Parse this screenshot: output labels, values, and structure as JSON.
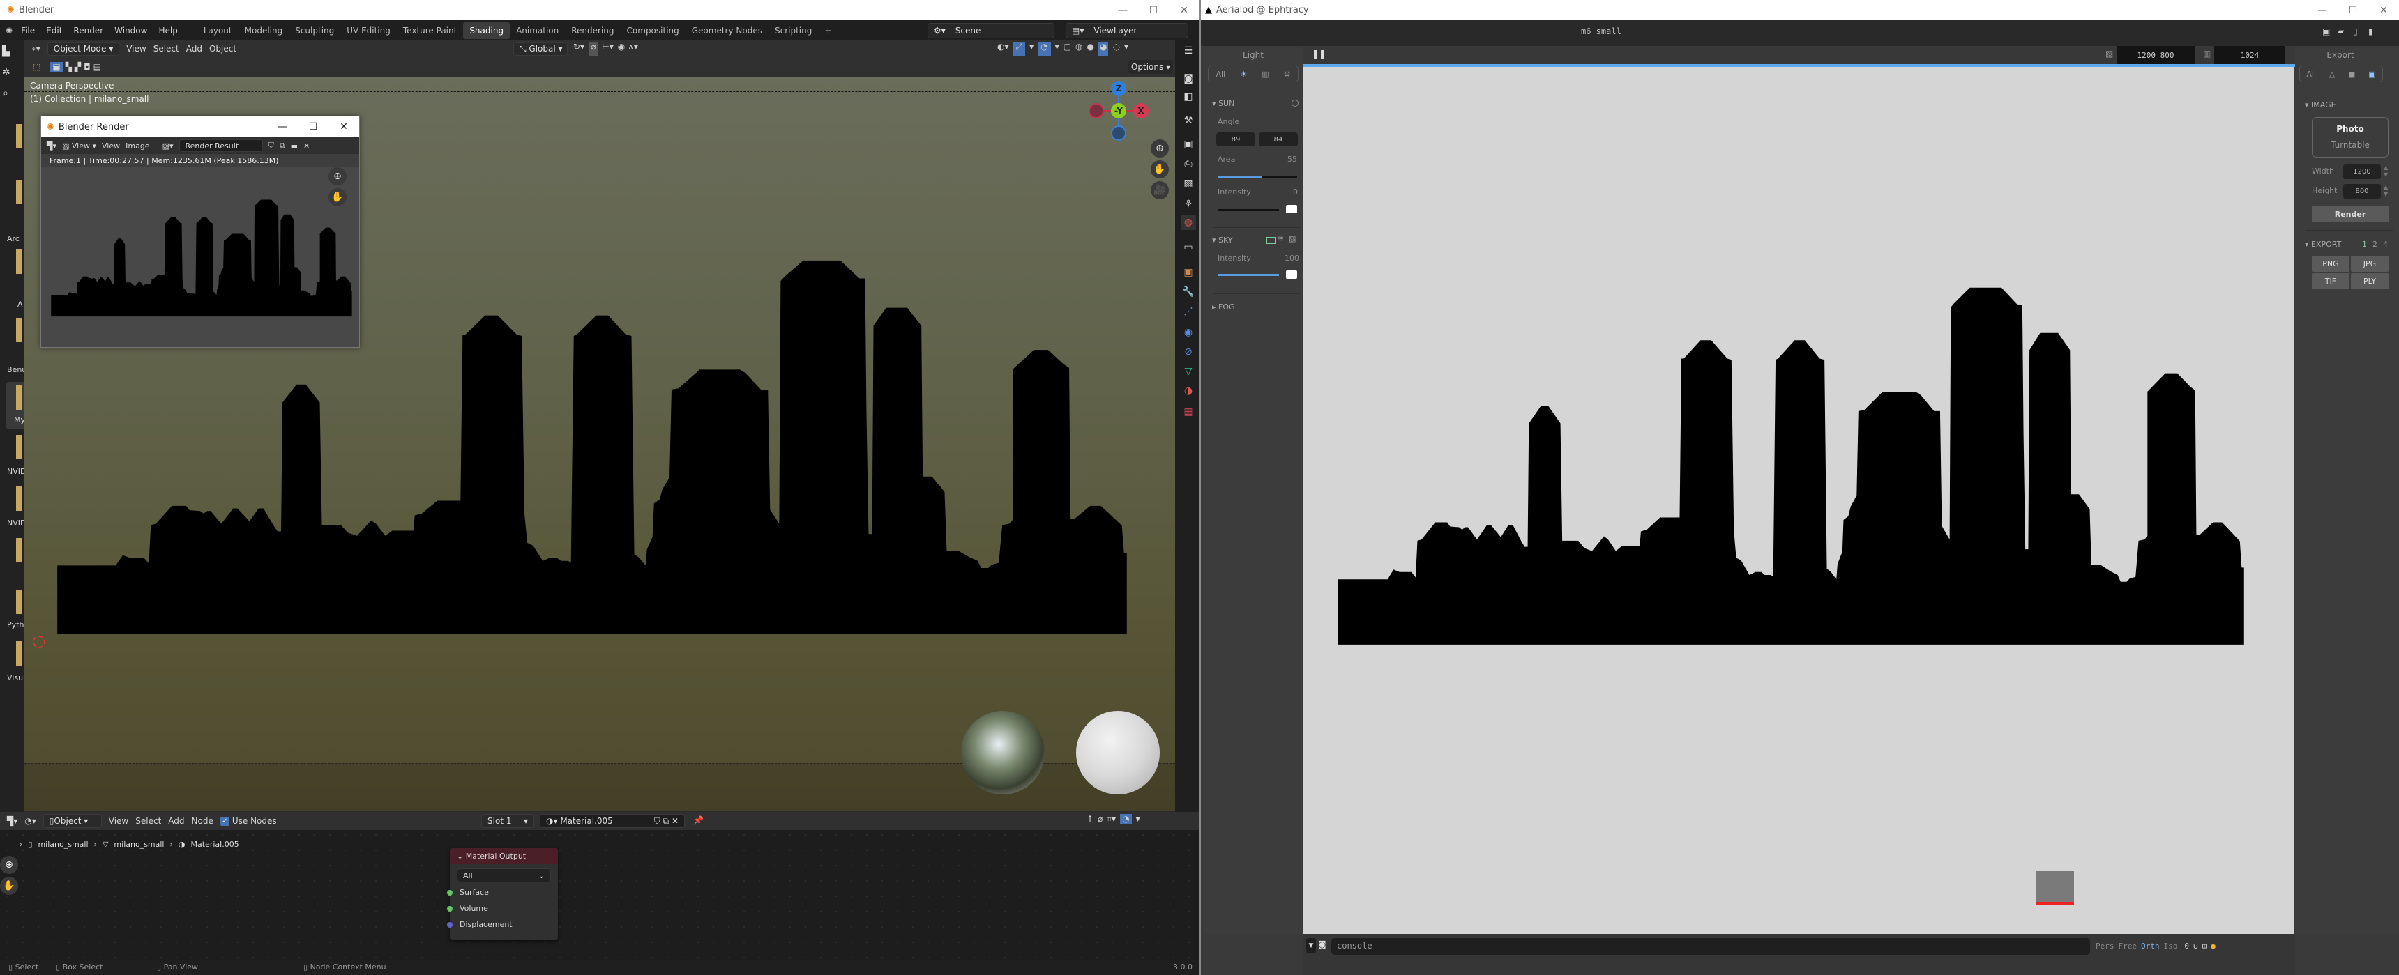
{
  "blender": {
    "window_title": "Blender",
    "menu": [
      "File",
      "Edit",
      "Render",
      "Window",
      "Help"
    ],
    "workspaces": [
      "Layout",
      "Modeling",
      "Sculpting",
      "UV Editing",
      "Texture Paint",
      "Shading",
      "Animation",
      "Rendering",
      "Compositing",
      "Geometry Nodes",
      "Scripting",
      "+"
    ],
    "active_workspace": "Shading",
    "scene": "Scene",
    "view_layer": "ViewLayer",
    "header": {
      "mode": "Object Mode",
      "items": [
        "View",
        "Select",
        "Add",
        "Object"
      ],
      "orientation": "Global",
      "options": "Options"
    },
    "viewport": {
      "camera_label": "Camera Perspective",
      "collection_label": "(1) Collection | milano_small"
    },
    "gizmo": {
      "z": "Z",
      "y": "-Y",
      "x": "X"
    },
    "desktop_strip_labels": [
      "Arc",
      "A",
      "Benu",
      "My",
      "NVID",
      "NVID",
      "Pyth",
      "Visu"
    ],
    "render_window": {
      "title": "Blender Render",
      "view_dropdown": "View",
      "menu": [
        "View",
        "Image"
      ],
      "image_name": "Render Result",
      "info": "Frame:1 | Time:00:27.57 | Mem:1235.61M (Peak 1586.13M)"
    },
    "node_editor": {
      "object_dropdown": "Object",
      "menu": [
        "View",
        "Select",
        "Add",
        "Node"
      ],
      "use_nodes_label": "Use Nodes",
      "use_nodes_checked": true,
      "slot": "Slot 1",
      "material": "Material.005",
      "breadcrumbs": [
        "milano_small",
        "milano_small",
        "Material.005"
      ],
      "node": {
        "title": "Material Output",
        "target": "All",
        "inputs": [
          {
            "name": "Surface",
            "color": "#63c763"
          },
          {
            "name": "Volume",
            "color": "#63c763"
          },
          {
            "name": "Displacement",
            "color": "#6363c7"
          }
        ]
      }
    },
    "status_bar": {
      "items": [
        "Select",
        "Box Select",
        "Pan View",
        "Node Context Menu"
      ],
      "version": "3.0.0"
    }
  },
  "aerialod": {
    "window_title": "Aerialod @ Ephtracy",
    "file_name": "m6_small",
    "resolution": "1200  800",
    "samples": "1024",
    "left_panel": {
      "title": "Light",
      "tabs": [
        "All"
      ],
      "sun": {
        "label": "SUN",
        "angle_label": "Angle",
        "angle": [
          "89",
          "84"
        ],
        "area_label": "Area",
        "area": "55",
        "area_fraction": 0.55,
        "intensity_label": "Intensity",
        "intensity": "0",
        "intensity_fraction": 0
      },
      "sky": {
        "label": "SKY",
        "intensity_label": "Intensity",
        "intensity": "100",
        "intensity_fraction": 1.0
      },
      "fog": {
        "label": "FOG"
      }
    },
    "right_panel": {
      "title": "Export",
      "tabs": [
        "All"
      ],
      "image": {
        "label": "IMAGE",
        "modes": [
          "Photo",
          "Turntable"
        ],
        "width_label": "Width",
        "width": "1200",
        "height_label": "Height",
        "height": "800",
        "render": "Render"
      },
      "export": {
        "label": "EXPORT",
        "scales": [
          "1",
          "2",
          "4"
        ],
        "active_scale": "1",
        "formats": [
          "PNG",
          "JPG",
          "TIF",
          "PLY"
        ]
      }
    },
    "console": {
      "placeholder": "console",
      "views": [
        "Pers",
        "Free",
        "Orth",
        "Iso"
      ],
      "active_view": "Orth",
      "value": "0"
    },
    "accent": "#5ea8f0"
  }
}
